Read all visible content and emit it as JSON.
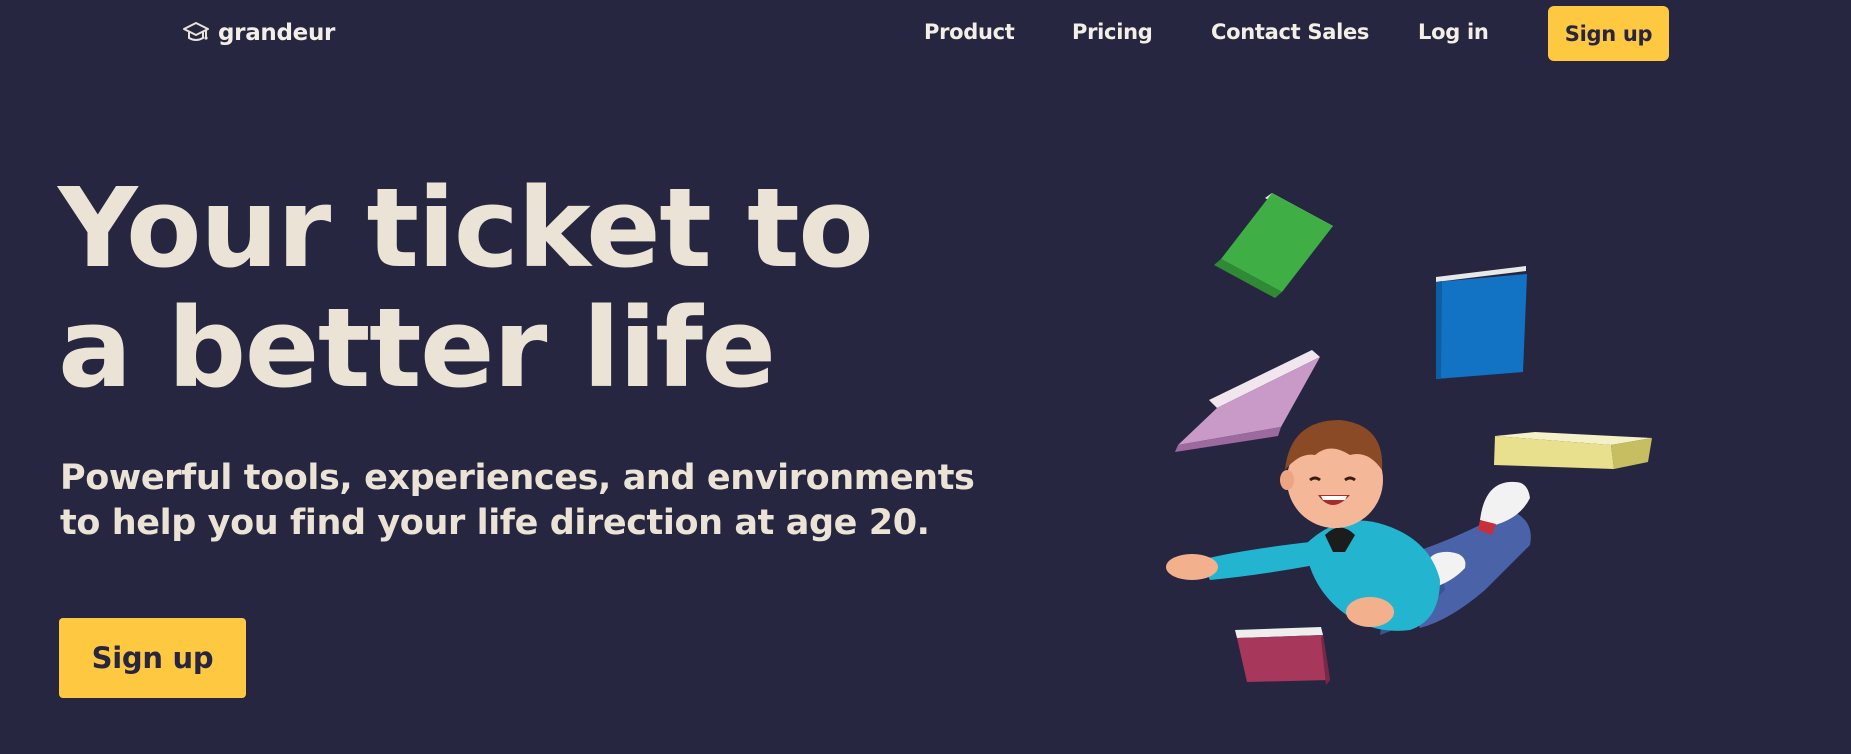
{
  "brand": {
    "name": "grandeur",
    "logo_icon": "graduation-cap-icon"
  },
  "nav": {
    "links": [
      "Product",
      "Pricing",
      "Contact Sales",
      "Log in"
    ],
    "signup_label": "Sign up"
  },
  "hero": {
    "title_lines": [
      "Your ticket to",
      "a better life"
    ],
    "subtitle_lines": [
      "Powerful tools, experiences, and environments",
      "to help you find your life direction at age 20."
    ],
    "cta_label": "Sign up"
  },
  "colors": {
    "background": "#272640",
    "accent": "#ffc841",
    "text": "#ebe4d6"
  }
}
